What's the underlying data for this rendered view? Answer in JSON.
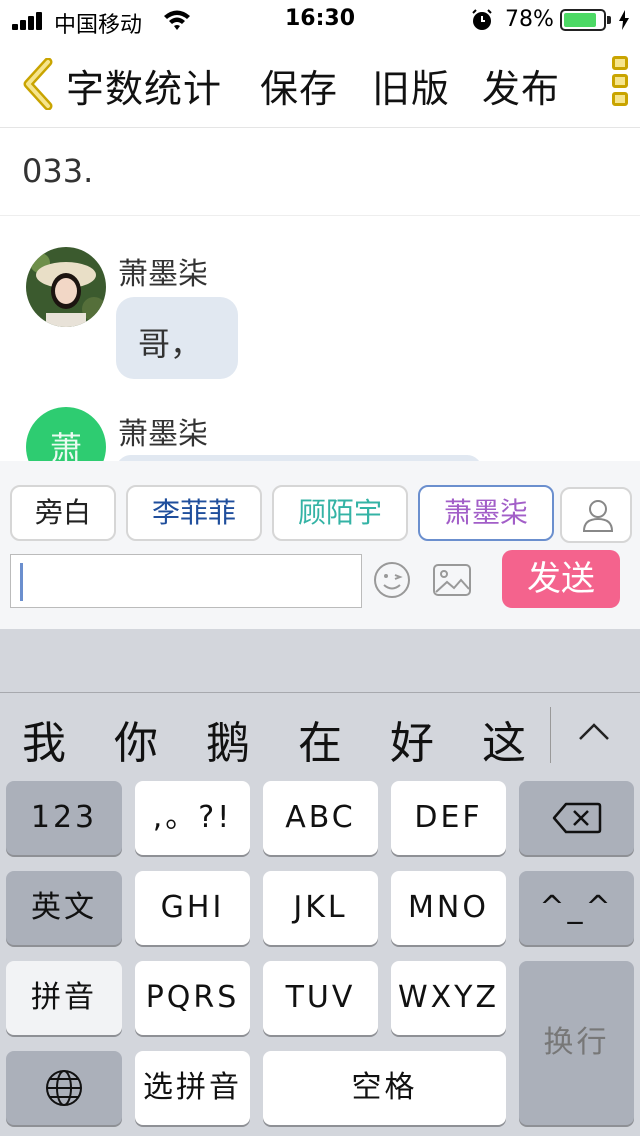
{
  "status_bar": {
    "carrier": "中国移动",
    "time": "16:30",
    "battery_percent": "78%",
    "battery_level": 0.78
  },
  "nav": {
    "word_count": "字数统计",
    "save": "保存",
    "old_version": "旧版",
    "publish": "发布"
  },
  "chapter_title": "033.",
  "messages": [
    {
      "name": "萧墨柒",
      "text": "哥，"
    },
    {
      "name": "萧墨柒",
      "avatar_char": "萧"
    }
  ],
  "roles": [
    "旁白",
    "李菲菲",
    "顾陌宇",
    "萧墨柒"
  ],
  "role_colors": [
    "#222222",
    "#1f4e9c",
    "#34b3a5",
    "#a25ec8"
  ],
  "send_label": "发送",
  "candidates": [
    "我",
    "你",
    "鹅",
    "在",
    "好",
    "这"
  ],
  "keys": {
    "num": "123",
    "punct": ",。?!",
    "abc": "ABC",
    "def": "DEF",
    "english": "英文",
    "ghi": "GHI",
    "jkl": "JKL",
    "mno": "MNO",
    "emoticon": "^_^",
    "pinyin": "拼音",
    "pqrs": "PQRS",
    "tuv": "TUV",
    "wxyz": "WXYZ",
    "newline": "换行",
    "select_pinyin": "选拼音",
    "space": "空格"
  }
}
